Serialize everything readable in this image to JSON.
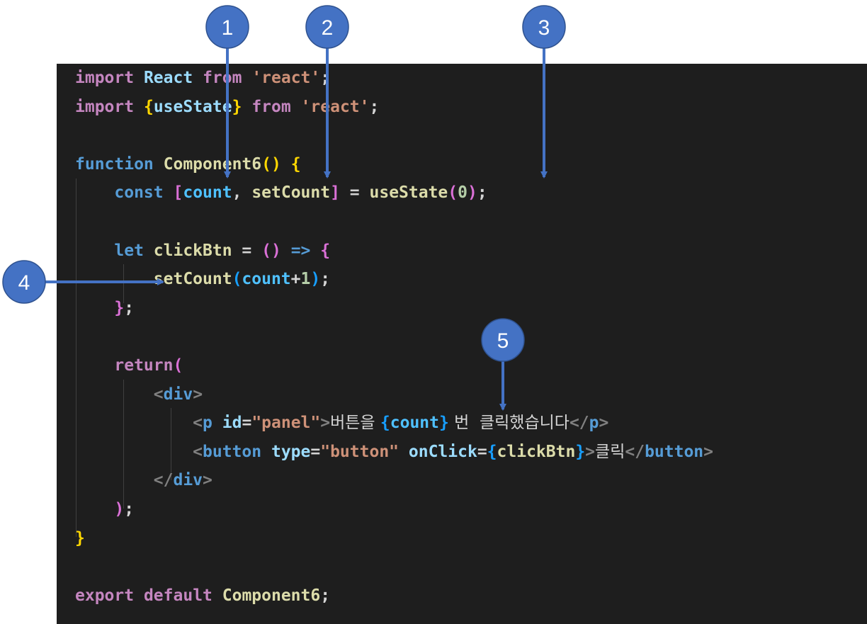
{
  "code_lines": [
    {
      "tokens": [
        {
          "t": "import",
          "c": "#c586c0"
        },
        {
          "t": " "
        },
        {
          "t": "React",
          "c": "#9cdcfe"
        },
        {
          "t": " "
        },
        {
          "t": "from",
          "c": "#c586c0"
        },
        {
          "t": " "
        },
        {
          "t": "'react'",
          "c": "#ce9178"
        },
        {
          "t": ";",
          "c": "#d4d4d4"
        }
      ]
    },
    {
      "tokens": [
        {
          "t": "import",
          "c": "#c586c0"
        },
        {
          "t": " "
        },
        {
          "t": "{",
          "c": "#ffd700"
        },
        {
          "t": "useState",
          "c": "#9cdcfe"
        },
        {
          "t": "}",
          "c": "#ffd700"
        },
        {
          "t": " "
        },
        {
          "t": "from",
          "c": "#c586c0"
        },
        {
          "t": " "
        },
        {
          "t": "'react'",
          "c": "#ce9178"
        },
        {
          "t": ";",
          "c": "#d4d4d4"
        }
      ]
    },
    {
      "tokens": []
    },
    {
      "tokens": [
        {
          "t": "function",
          "c": "#569cd6"
        },
        {
          "t": " "
        },
        {
          "t": "Component6",
          "c": "#dcdcaa"
        },
        {
          "t": "()",
          "c": "#ffd700"
        },
        {
          "t": " "
        },
        {
          "t": "{",
          "c": "#ffd700"
        }
      ]
    },
    {
      "tokens": [
        {
          "t": "    "
        },
        {
          "t": "const",
          "c": "#569cd6"
        },
        {
          "t": " "
        },
        {
          "t": "[",
          "c": "#da70d6"
        },
        {
          "t": "count",
          "c": "#4fc1ff"
        },
        {
          "t": ", ",
          "c": "#d4d4d4"
        },
        {
          "t": "setCount",
          "c": "#dcdcaa"
        },
        {
          "t": "]",
          "c": "#da70d6"
        },
        {
          "t": " = ",
          "c": "#d4d4d4"
        },
        {
          "t": "useState",
          "c": "#dcdcaa"
        },
        {
          "t": "(",
          "c": "#da70d6"
        },
        {
          "t": "0",
          "c": "#b5cea8"
        },
        {
          "t": ")",
          "c": "#da70d6"
        },
        {
          "t": ";",
          "c": "#d4d4d4"
        }
      ]
    },
    {
      "tokens": []
    },
    {
      "tokens": [
        {
          "t": "    "
        },
        {
          "t": "let",
          "c": "#569cd6"
        },
        {
          "t": " "
        },
        {
          "t": "clickBtn",
          "c": "#dcdcaa"
        },
        {
          "t": " = ",
          "c": "#d4d4d4"
        },
        {
          "t": "()",
          "c": "#da70d6"
        },
        {
          "t": " "
        },
        {
          "t": "=>",
          "c": "#569cd6"
        },
        {
          "t": " "
        },
        {
          "t": "{",
          "c": "#da70d6"
        }
      ]
    },
    {
      "tokens": [
        {
          "t": "        "
        },
        {
          "t": "setCount",
          "c": "#dcdcaa"
        },
        {
          "t": "(",
          "c": "#179fff"
        },
        {
          "t": "count",
          "c": "#4fc1ff"
        },
        {
          "t": "+",
          "c": "#d4d4d4"
        },
        {
          "t": "1",
          "c": "#b5cea8"
        },
        {
          "t": ")",
          "c": "#179fff"
        },
        {
          "t": ";",
          "c": "#d4d4d4"
        }
      ]
    },
    {
      "tokens": [
        {
          "t": "    "
        },
        {
          "t": "}",
          "c": "#da70d6"
        },
        {
          "t": ";",
          "c": "#d4d4d4"
        }
      ]
    },
    {
      "tokens": []
    },
    {
      "tokens": [
        {
          "t": "    "
        },
        {
          "t": "return",
          "c": "#c586c0"
        },
        {
          "t": "(",
          "c": "#da70d6"
        }
      ]
    },
    {
      "tokens": [
        {
          "t": "        "
        },
        {
          "t": "<",
          "c": "#808080"
        },
        {
          "t": "div",
          "c": "#569cd6"
        },
        {
          "t": ">",
          "c": "#808080"
        }
      ]
    },
    {
      "tokens": [
        {
          "t": "            "
        },
        {
          "t": "<",
          "c": "#808080"
        },
        {
          "t": "p",
          "c": "#569cd6"
        },
        {
          "t": " "
        },
        {
          "t": "id",
          "c": "#9cdcfe"
        },
        {
          "t": "=",
          "c": "#d4d4d4"
        },
        {
          "t": "\"panel\"",
          "c": "#ce9178"
        },
        {
          "t": ">",
          "c": "#808080"
        },
        {
          "t": "버튼을 ",
          "c": "#d4d4d4",
          "kr": true
        },
        {
          "t": "{",
          "c": "#179fff"
        },
        {
          "t": "count",
          "c": "#4fc1ff"
        },
        {
          "t": "}",
          "c": "#179fff"
        },
        {
          "t": " 번  클릭했습니다",
          "c": "#d4d4d4",
          "kr": true
        },
        {
          "t": "</",
          "c": "#808080"
        },
        {
          "t": "p",
          "c": "#569cd6"
        },
        {
          "t": ">",
          "c": "#808080"
        }
      ]
    },
    {
      "tokens": [
        {
          "t": "            "
        },
        {
          "t": "<",
          "c": "#808080"
        },
        {
          "t": "button",
          "c": "#569cd6"
        },
        {
          "t": " "
        },
        {
          "t": "type",
          "c": "#9cdcfe"
        },
        {
          "t": "=",
          "c": "#d4d4d4"
        },
        {
          "t": "\"button\"",
          "c": "#ce9178"
        },
        {
          "t": " "
        },
        {
          "t": "onClick",
          "c": "#9cdcfe"
        },
        {
          "t": "=",
          "c": "#d4d4d4"
        },
        {
          "t": "{",
          "c": "#179fff"
        },
        {
          "t": "clickBtn",
          "c": "#dcdcaa"
        },
        {
          "t": "}",
          "c": "#179fff"
        },
        {
          "t": ">",
          "c": "#808080"
        },
        {
          "t": "클릭",
          "c": "#d4d4d4",
          "kr": true
        },
        {
          "t": "</",
          "c": "#808080"
        },
        {
          "t": "button",
          "c": "#569cd6"
        },
        {
          "t": ">",
          "c": "#808080"
        }
      ]
    },
    {
      "tokens": [
        {
          "t": "        "
        },
        {
          "t": "</",
          "c": "#808080"
        },
        {
          "t": "div",
          "c": "#569cd6"
        },
        {
          "t": ">",
          "c": "#808080"
        }
      ]
    },
    {
      "tokens": [
        {
          "t": "    "
        },
        {
          "t": ")",
          "c": "#da70d6"
        },
        {
          "t": ";",
          "c": "#d4d4d4"
        }
      ]
    },
    {
      "tokens": [
        {
          "t": "}",
          "c": "#ffd700"
        }
      ]
    },
    {
      "tokens": []
    },
    {
      "tokens": [
        {
          "t": "export",
          "c": "#c586c0"
        },
        {
          "t": " "
        },
        {
          "t": "default",
          "c": "#c586c0"
        },
        {
          "t": " "
        },
        {
          "t": "Component6",
          "c": "#dcdcaa"
        },
        {
          "t": ";",
          "c": "#d4d4d4"
        }
      ]
    }
  ],
  "callouts": [
    {
      "number": "1"
    },
    {
      "number": "2"
    },
    {
      "number": "3"
    },
    {
      "number": "4"
    },
    {
      "number": "5"
    }
  ],
  "colors": {
    "editor_background": "#1e1e1e",
    "callout_fill": "#4472c4",
    "callout_stroke": "#2f528f",
    "callout_arrow": "#4472c4"
  }
}
